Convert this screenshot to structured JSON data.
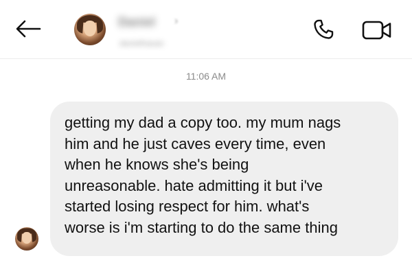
{
  "header": {
    "back_icon": "arrow-left-icon",
    "contact_name": "Daniel",
    "contact_username": "danielhasan",
    "call_icon": "phone-icon",
    "video_icon": "video-camera-icon"
  },
  "thread": {
    "timestamp": "11:06 AM",
    "messages": [
      {
        "direction": "incoming",
        "text": "getting my dad a copy too. my mum nags\nhim and he just caves every time, even\nwhen he knows she's being\nunreasonable. hate admitting it but i've\nstarted losing respect for him. what's\nworse is i'm starting to do the same thing"
      }
    ]
  },
  "colors": {
    "bubble_background": "#efefef",
    "timestamp_text": "#8a8a8a",
    "icon_stroke": "#111111"
  }
}
